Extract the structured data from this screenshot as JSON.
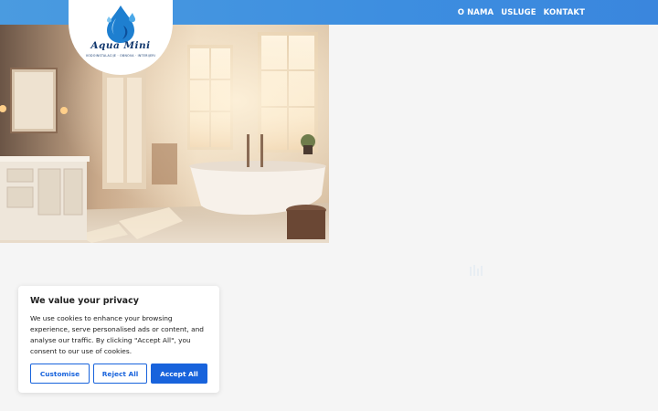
{
  "header": {
    "nav": [
      {
        "label": "O NAMA"
      },
      {
        "label": "USLUGE"
      },
      {
        "label": "KONTAKT"
      }
    ]
  },
  "logo": {
    "name": "Aqua Mini",
    "tagline": "VODOINSTALACIJE · OBNOVA · INTERIJERI",
    "icon": "water-drop-icon"
  },
  "hero": {
    "image": "bathroom-photo"
  },
  "cookie_banner": {
    "title": "We value your privacy",
    "text": "We use cookies to enhance your browsing experience, serve personalised ads or content, and analyse our traffic. By clicking \"Accept All\", you consent to our use of cookies.",
    "buttons": {
      "customise": "Customise",
      "reject": "Reject All",
      "accept": "Accept All"
    }
  },
  "colors": {
    "header_blue": "#3d8ee0",
    "accent": "#1863dc"
  }
}
